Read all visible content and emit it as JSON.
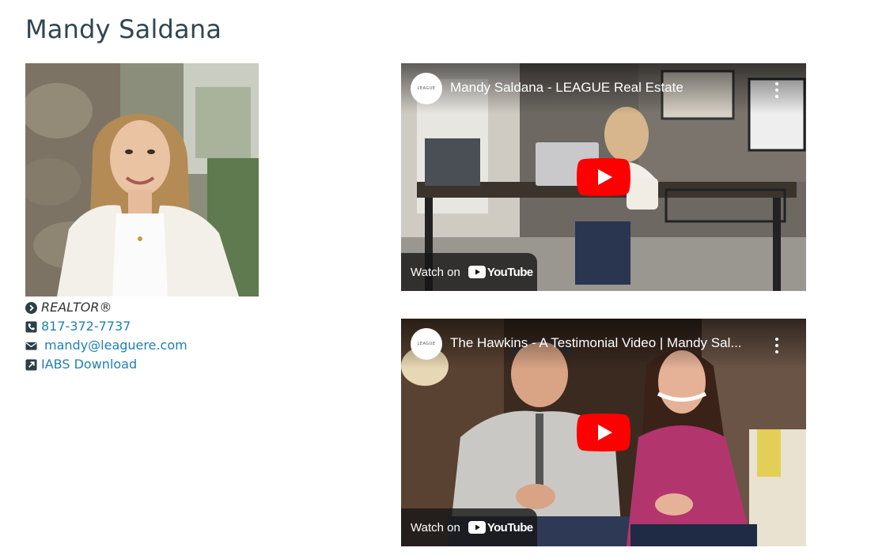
{
  "profile": {
    "name": "Mandy Saldana",
    "role": "REALTOR®",
    "phone": "817-372-7737",
    "email": "mandy@leaguere.com",
    "iabs_label": "IABS Download"
  },
  "videos": [
    {
      "title": "Mandy Saldana - LEAGUE Real Estate",
      "channel_avatar_text": "LEAGUE",
      "watch_on_label": "Watch on",
      "youtube_label": "YouTube"
    },
    {
      "title": "The Hawkins - A Testimonial Video | Mandy Sal...",
      "channel_avatar_text": "LEAGUE",
      "watch_on_label": "Watch on",
      "youtube_label": "YouTube"
    }
  ],
  "colors": {
    "link": "#1f7fb3",
    "title": "#2f4650",
    "youtube_red": "#ff0000"
  },
  "icons": {
    "role": "chevron-circle-right-icon",
    "phone": "phone-square-icon",
    "email": "envelope-icon",
    "iabs": "external-link-square-icon"
  }
}
